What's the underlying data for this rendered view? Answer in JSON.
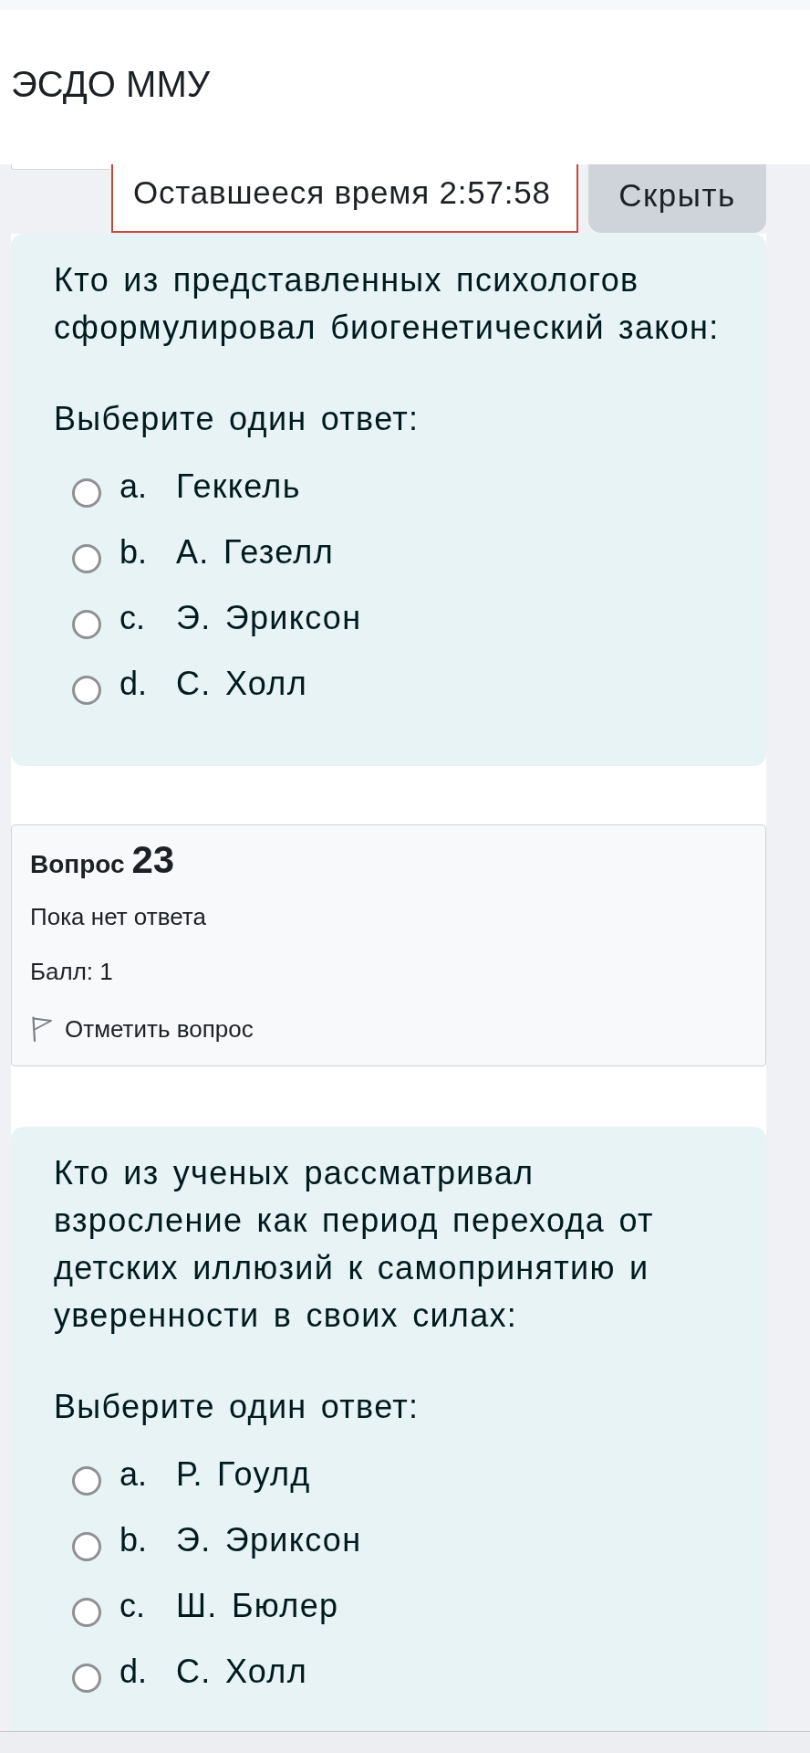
{
  "header": {
    "title": "ЭСДО ММУ"
  },
  "timer": {
    "text": "Оставшееся время 2:57:58"
  },
  "hide_button": {
    "label": "Скрыть"
  },
  "blocks": [
    {
      "kind": "formulation",
      "question": "Кто из представленных психологов сформулировал биогенетический закон:",
      "prompt": "Выберите один ответ:",
      "options": [
        {
          "letter": "a.",
          "text": "Геккель",
          "selected": false
        },
        {
          "letter": "b.",
          "text": "А. Гезелл",
          "selected": false
        },
        {
          "letter": "c.",
          "text": "Э. Эриксон",
          "selected": false
        },
        {
          "letter": "d.",
          "text": "С. Холл",
          "selected": false
        }
      ]
    },
    {
      "kind": "info",
      "label": "Вопрос",
      "number": "23",
      "status": "Пока нет ответа",
      "grade": "Балл: 1",
      "flag": {
        "label": "Отметить вопрос",
        "flagged": false
      }
    },
    {
      "kind": "formulation",
      "question": "Кто из ученых рассматривал взросление как период перехода от детских иллюзий к самопринятию и уверенности в своих силах:",
      "prompt": "Выберите один ответ:",
      "options": [
        {
          "letter": "a.",
          "text": "Р. Гоулд",
          "selected": false
        },
        {
          "letter": "b.",
          "text": "Э. Эриксон",
          "selected": false
        },
        {
          "letter": "c.",
          "text": "Ш. Бюлер",
          "selected": false
        },
        {
          "letter": "d.",
          "text": "С. Холл",
          "selected": false
        }
      ]
    }
  ]
}
